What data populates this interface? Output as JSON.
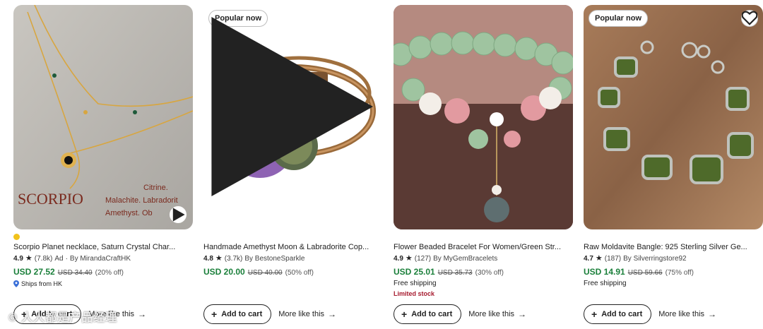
{
  "products": [
    {
      "title": "Scorpio Planet necklace, Saturn Crystal Char...",
      "rating": "4.9",
      "reviews": "(7.8k)",
      "ad": "Ad",
      "shop": "By MirandaCraftHK",
      "price": "USD 27.52",
      "original_price": "USD 34.40",
      "discount": "(20% off)",
      "shipping": "Ships from HK",
      "image_text": {
        "brand": "SCORPIO",
        "line1": "Citrine.",
        "line2": "Malachite. Labradorit",
        "line3": "Amethyst. Ob"
      }
    },
    {
      "badge": "Popular now",
      "title": "Handmade Amethyst Moon & Labradorite Cop...",
      "rating": "4.8",
      "reviews": "(3.7k)",
      "shop": "By BestoneSparkle",
      "price": "USD 20.00",
      "original_price": "USD 40.00",
      "discount": "(50% off)"
    },
    {
      "title": "Flower Beaded Bracelet For Women/Green Str...",
      "rating": "4.9",
      "reviews": "(127)",
      "shop": "By MyGemBracelets",
      "price": "USD 25.01",
      "original_price": "USD 35.73",
      "discount": "(30% off)",
      "shipping": "Free shipping",
      "stock": "Limited stock"
    },
    {
      "badge": "Popular now",
      "title": "Raw Moldavite Bangle: 925 Sterling Silver Ge...",
      "rating": "4.7",
      "reviews": "(187)",
      "shop": "By Silverringstore92",
      "price": "USD 14.91",
      "original_price": "USD 59.66",
      "discount": "(75% off)",
      "shipping": "Free shipping"
    }
  ],
  "actions": {
    "add_to_cart": "Add to cart",
    "more_like_this": "More like this"
  },
  "watermark": "© 人人都是产品经理",
  "colors": {
    "price_green": "#1a7f3a",
    "limited_red": "#a61a2e",
    "bestseller_dot": "#f1c21b"
  }
}
